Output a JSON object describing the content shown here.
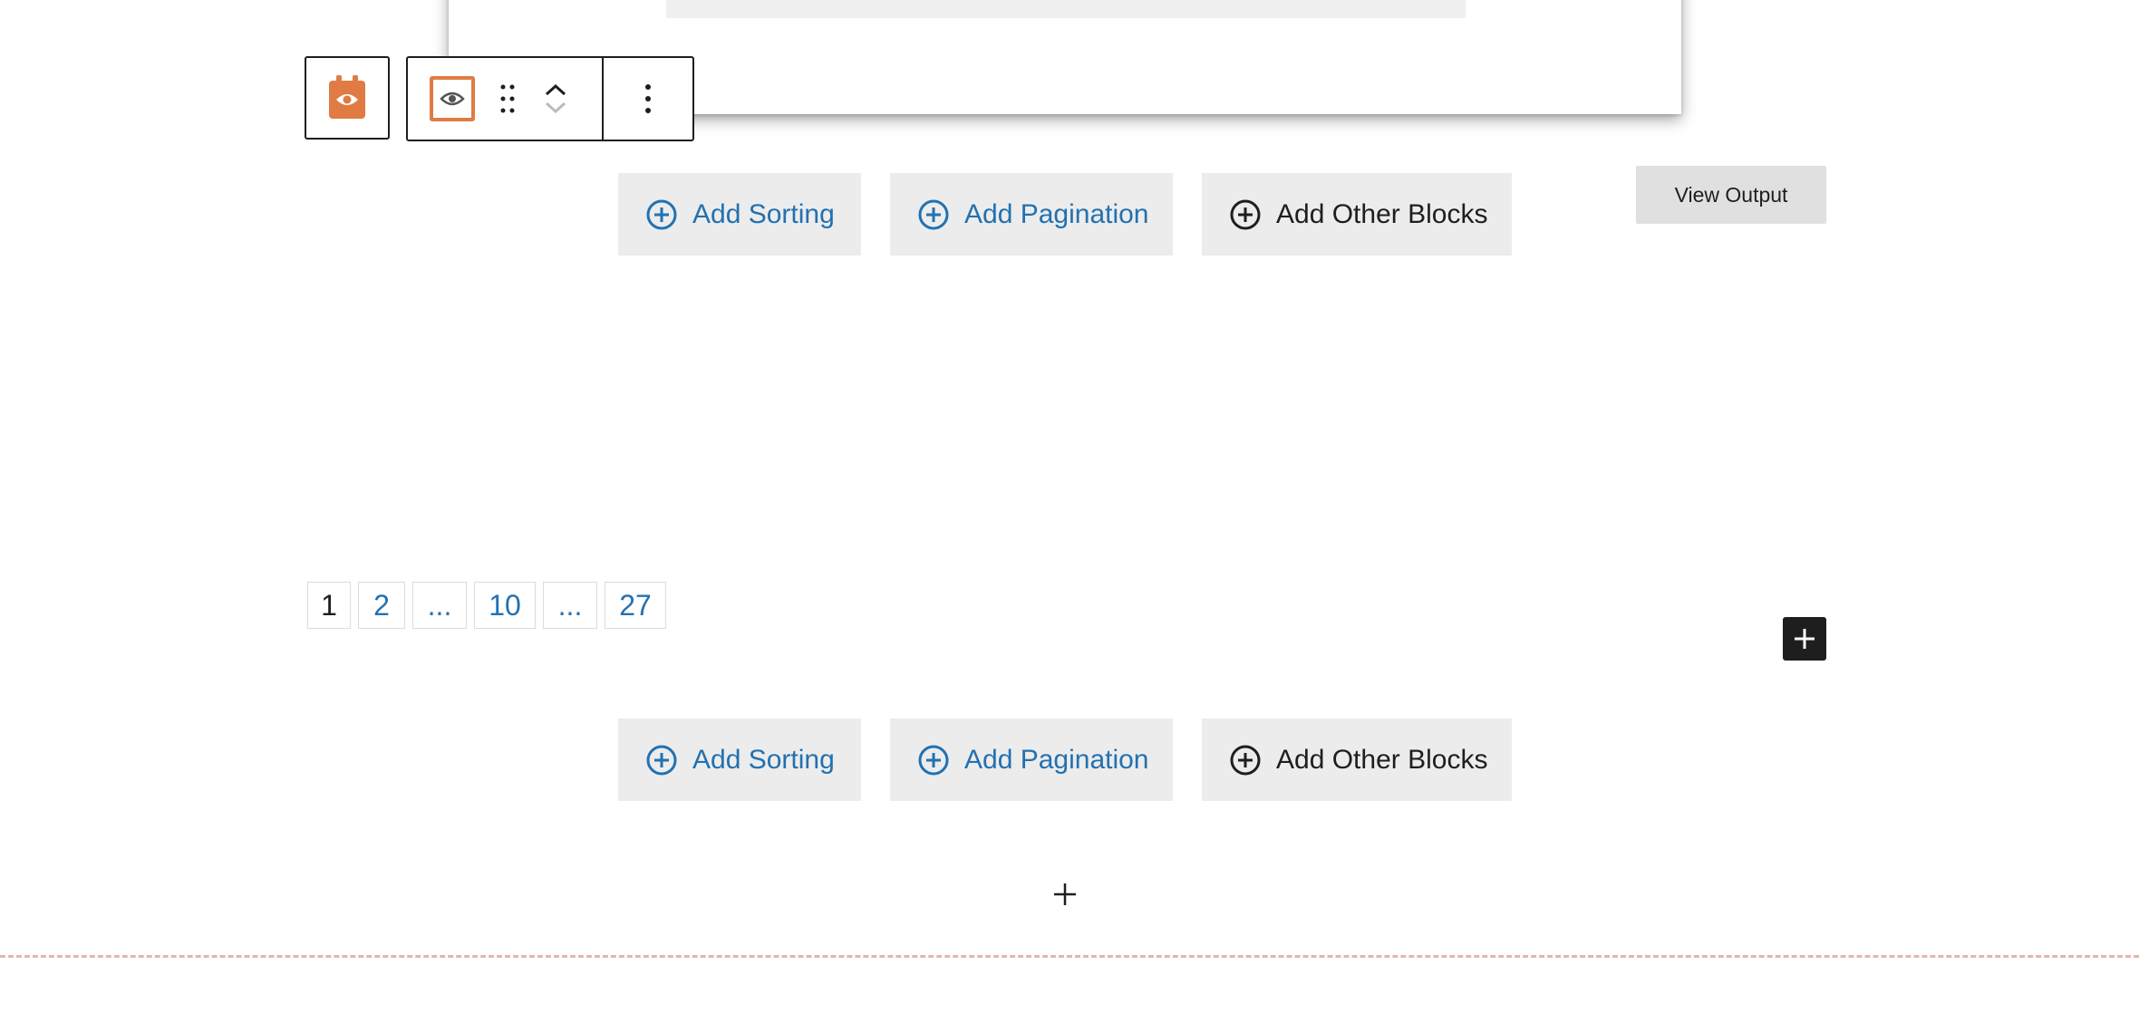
{
  "colors": {
    "accent": "#e07b44",
    "link": "#2271b1",
    "dark": "#1e1e1e",
    "button_bg": "#ececec",
    "separator": "#e4b5a8"
  },
  "toolbar": {
    "parent_icon": "calendar-eye-icon",
    "block_icon": "eye-icon",
    "drag_icon": "drag-handle-icon",
    "move_up_icon": "chevron-up-icon",
    "move_down_icon": "chevron-down-icon",
    "options_icon": "more-vertical-icon"
  },
  "actions_top": {
    "sorting": "Add Sorting",
    "pagination": "Add Pagination",
    "other": "Add Other Blocks"
  },
  "view_output": "View Output",
  "pagination": {
    "pages": [
      "1",
      "2",
      "...",
      "10",
      "...",
      "27"
    ],
    "current": "1"
  },
  "actions_bottom": {
    "sorting": "Add Sorting",
    "pagination": "Add Pagination",
    "other": "Add Other Blocks"
  }
}
